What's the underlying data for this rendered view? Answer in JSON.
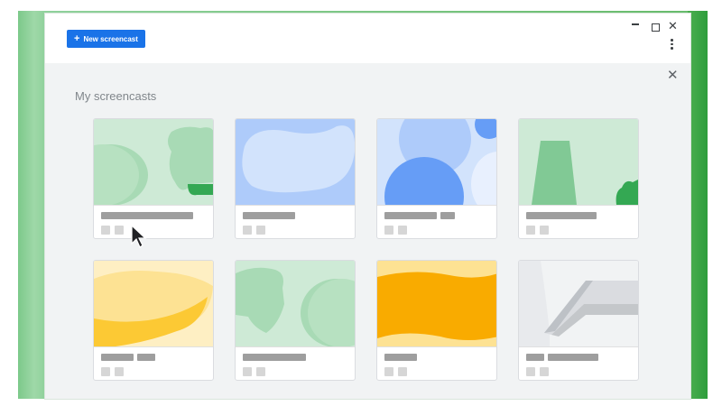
{
  "toolbar": {
    "new_button_label": "New screencast"
  },
  "window_controls": [
    "minimize-icon",
    "maximize-icon",
    "close-icon",
    "more-vert-icon"
  ],
  "main": {
    "heading": "My screencasts",
    "close_icon": "close-icon",
    "cards": [
      {
        "name": "screencast-card-1",
        "thumb_colors": [
          "#ceead6",
          "#a8dab5",
          "#81c995",
          "#34a853"
        ]
      },
      {
        "name": "screencast-card-2",
        "thumb_colors": [
          "#aecbfa",
          "#d2e3fc"
        ]
      },
      {
        "name": "screencast-card-3",
        "thumb_colors": [
          "#d2e3fc",
          "#aecbfa",
          "#669df6",
          "#e8f0fe"
        ]
      },
      {
        "name": "screencast-card-4",
        "thumb_colors": [
          "#ceead6",
          "#81c995",
          "#34a853"
        ]
      },
      {
        "name": "screencast-card-5",
        "thumb_colors": [
          "#feefc3",
          "#fde293",
          "#fcc934"
        ]
      },
      {
        "name": "screencast-card-6",
        "thumb_colors": [
          "#ceead6",
          "#a8dab5",
          "#81c995"
        ]
      },
      {
        "name": "screencast-card-7",
        "thumb_colors": [
          "#fde293",
          "#f9ab00",
          "#fcc934"
        ]
      },
      {
        "name": "screencast-card-8",
        "thumb_colors": [
          "#f1f3f4",
          "#dadce0",
          "#bdc1c6"
        ]
      }
    ]
  },
  "colors": {
    "accent": "#1a73e8",
    "background_frame": "#66bb6a"
  }
}
